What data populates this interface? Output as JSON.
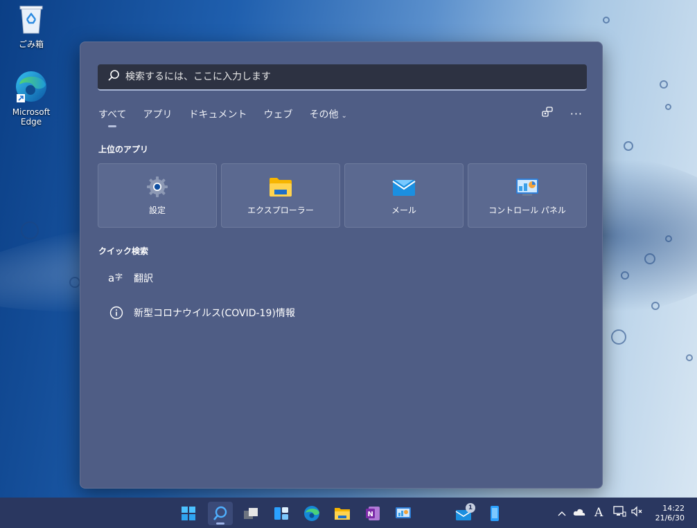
{
  "desktop": {
    "icons": [
      {
        "label": "ごみ箱"
      },
      {
        "label": "Microsoft Edge"
      }
    ]
  },
  "search": {
    "placeholder": "検索するには、ここに入力します",
    "tabs": [
      {
        "label": "すべて"
      },
      {
        "label": "アプリ"
      },
      {
        "label": "ドキュメント"
      },
      {
        "label": "ウェブ"
      },
      {
        "label": "その他"
      }
    ],
    "top_apps_title": "上位のアプリ",
    "top_apps": [
      {
        "label": "設定",
        "icon": "settings-gear-icon"
      },
      {
        "label": "エクスプローラー",
        "icon": "folder-icon"
      },
      {
        "label": "メール",
        "icon": "mail-icon"
      },
      {
        "label": "コントロール パネル",
        "icon": "control-panel-icon"
      }
    ],
    "quick_title": "クイック検索",
    "quick_items": [
      {
        "label": "翻訳",
        "icon": "translate-icon"
      },
      {
        "label": "新型コロナウイルス(COVID-19)情報",
        "icon": "info-icon"
      }
    ]
  },
  "taskbar": {
    "mail_badge": "1",
    "clock": {
      "time": "14:22",
      "date": "21/6/30"
    },
    "ime": "A"
  },
  "colors": {
    "panel": "#4f5d85",
    "tile": "#5b6990",
    "taskbar": "#2a3760",
    "search_box": "#2d3242"
  }
}
